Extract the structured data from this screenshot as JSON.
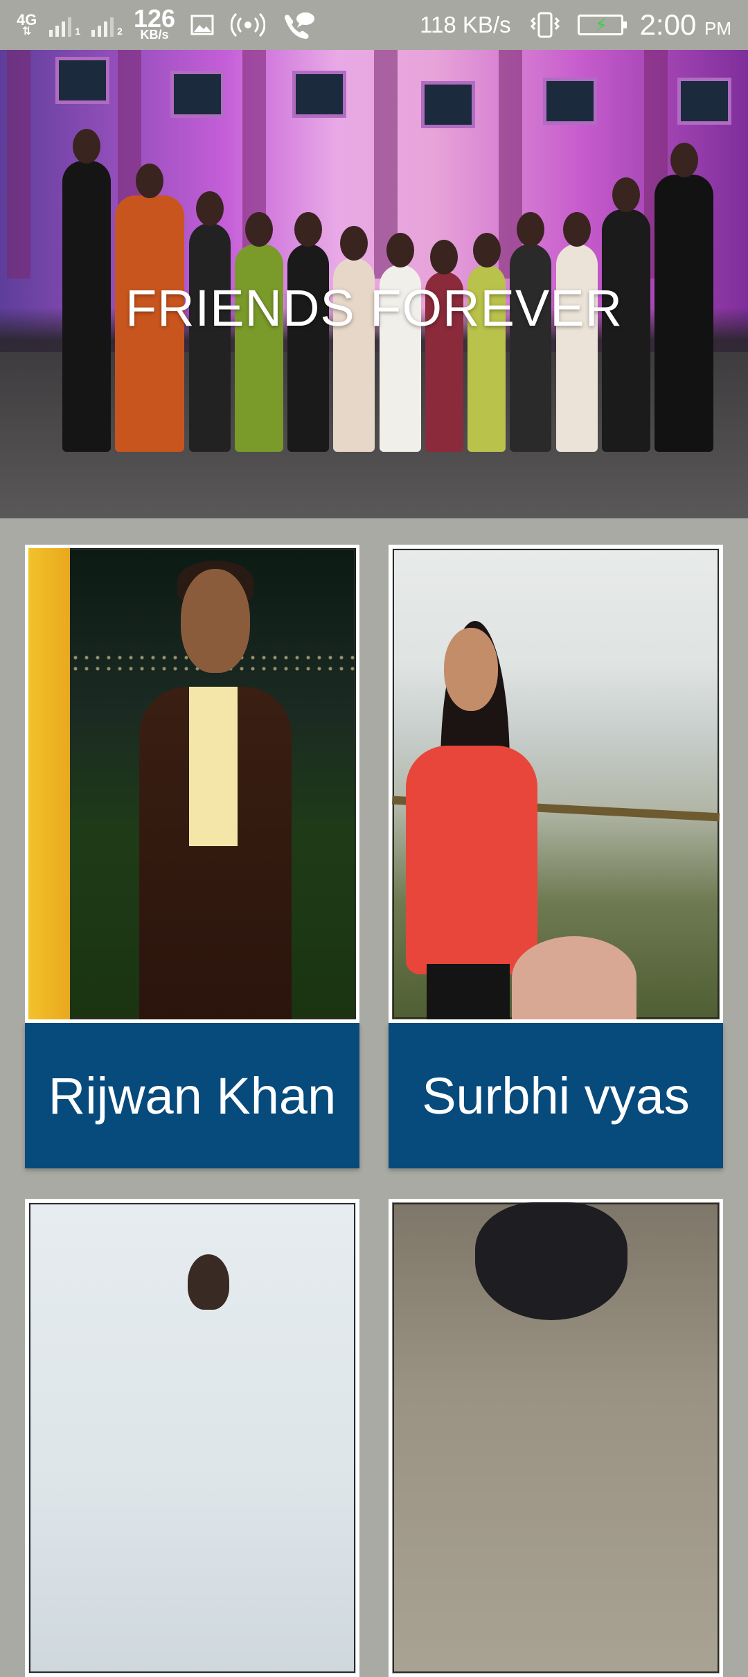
{
  "status_bar": {
    "network_type": "4G",
    "sim1_label": "1",
    "sim2_label": "2",
    "data_speed_value": "126",
    "data_speed_unit": "KB/s",
    "transfer_rate": "118 KB/s",
    "time": "2:00",
    "time_suffix": "PM",
    "icons": [
      "signal-icon",
      "image-icon",
      "hotspot-icon",
      "call-chat-icon",
      "vibrate-icon",
      "battery-charging-icon"
    ]
  },
  "banner": {
    "title": "FRIENDS FOREVER"
  },
  "cards": [
    {
      "name": "Rijwan Khan"
    },
    {
      "name": "Surbhi vyas"
    },
    {
      "name": ""
    },
    {
      "name": ""
    }
  ],
  "colors": {
    "name_bar": "#074a7c",
    "background": "#a9aaa4",
    "status_bar": "#a8a8a2"
  }
}
